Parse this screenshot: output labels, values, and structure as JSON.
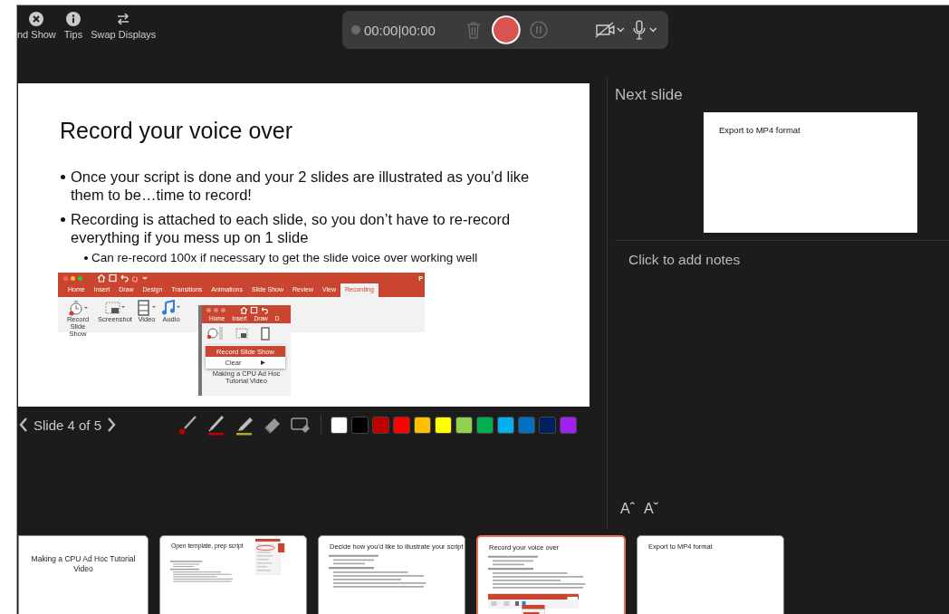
{
  "toolbar": [
    {
      "kind": "close",
      "label": "nd Show"
    },
    {
      "kind": "info",
      "label": "Tips"
    },
    {
      "kind": "swap",
      "label": "Swap Displays"
    }
  ],
  "recorder": {
    "recording": false,
    "time": "00:00|00:00",
    "camera_on": false
  },
  "current_slide": {
    "title": "Record your voice over",
    "bullets": [
      {
        "text": "Once your script is done and your 2 slides are illustrated as you’d like them to be…time to record!"
      },
      {
        "text": "Recording is attached to each slide, so you don’t have to re-record everything if you mess up on 1 slide",
        "children": [
          "Can re-record 100x if necessary to get the slide voice over working well"
        ]
      }
    ],
    "screenshot": {
      "title_fragment": "P",
      "tabs": [
        {
          "label": "Home",
          "selected": false
        },
        {
          "label": "Insert",
          "selected": false
        },
        {
          "label": "Draw",
          "selected": false
        },
        {
          "label": "Design",
          "selected": false
        },
        {
          "label": "Transitions",
          "selected": false
        },
        {
          "label": "Animations",
          "selected": false
        },
        {
          "label": "Slide Show",
          "selected": false
        },
        {
          "label": "Review",
          "selected": false
        },
        {
          "label": "View",
          "selected": false
        },
        {
          "label": "Recording",
          "selected": true
        }
      ],
      "ribbon_buttons": [
        {
          "kind": "timer",
          "label": "Record Slide Show"
        },
        {
          "kind": "screenshot",
          "label": "Screenshot"
        },
        {
          "kind": "video",
          "label": "Video"
        },
        {
          "kind": "audio",
          "label": "Audio"
        }
      ],
      "popup": {
        "tabs": [
          "Home",
          "Insert",
          "Draw",
          "D"
        ],
        "menu": [
          {
            "label": "Record Slide Show",
            "selected": true,
            "submenu": false
          },
          {
            "label": "Clear",
            "selected": false,
            "submenu": true
          }
        ],
        "caption": "Making a CPU Ad Hoc Tutorial Video"
      }
    }
  },
  "slide_nav": {
    "label": "Slide 4 of 5"
  },
  "pens": [
    {
      "kind": "laser",
      "color": "#c00000"
    },
    {
      "kind": "pen",
      "color": "#c00000"
    },
    {
      "kind": "highlighter",
      "color": "#b5a81c"
    },
    {
      "kind": "eraser"
    },
    {
      "kind": "clear"
    }
  ],
  "palette": [
    {
      "color": "#ffffff"
    },
    {
      "color": "#000000"
    },
    {
      "color": "#c00000"
    },
    {
      "color": "#ff0000"
    },
    {
      "color": "#ffc000"
    },
    {
      "color": "#ffff00"
    },
    {
      "color": "#92d050"
    },
    {
      "color": "#00b050"
    },
    {
      "color": "#00b0f0"
    },
    {
      "color": "#0070c0"
    },
    {
      "color": "#002060"
    },
    {
      "color": "#a020f0"
    }
  ],
  "next_slide": {
    "heading": "Next slide",
    "title": "Export to MP4 format"
  },
  "notes": {
    "placeholder": "Click to add notes"
  },
  "font_buttons": [
    "Aˆ",
    "Aˇ"
  ],
  "thumbnails": [
    {
      "kind": "title",
      "selected": false,
      "title": "Making a CPU Ad Hoc Tutorial Video"
    },
    {
      "kind": "side_screenshot",
      "selected": false,
      "title": "Open template, prep script"
    },
    {
      "kind": "bullets",
      "selected": false,
      "title": "Decide how you’d like to illustrate your script"
    },
    {
      "kind": "below_screenshot",
      "selected": true,
      "title": "Record your voice over"
    },
    {
      "kind": "heading",
      "selected": false,
      "title": "Export to MP4 format"
    }
  ]
}
